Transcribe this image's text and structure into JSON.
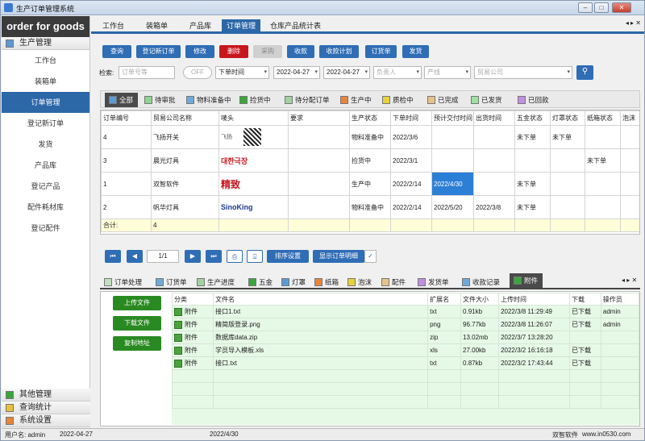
{
  "window": {
    "title": "生产订单管理系统",
    "min": "–",
    "max": "□",
    "close": "✕"
  },
  "brand": "order for goods",
  "sidebar": {
    "group_label": "生产管理",
    "items": [
      "工作台",
      "装箱单",
      "订单管理",
      "登记新订单",
      "发货",
      "产品库",
      "登记产品",
      "配件耗材库",
      "登记配件"
    ],
    "bottom_groups": [
      {
        "label": "其他管理",
        "color": "#3aa63a"
      },
      {
        "label": "查询统计",
        "color": "#e8c23a"
      },
      {
        "label": "系统设置",
        "color": "#e8843a"
      }
    ]
  },
  "top_tabs": [
    "工作台",
    "装箱单",
    "产品库",
    "订单管理",
    "仓库产品统计表"
  ],
  "top_arrows": "◂ ▸ ✕",
  "toolbar": [
    "查询",
    "登记新订单",
    "修改",
    "删除",
    "采购",
    "收款",
    "收款计划",
    "订货单",
    "发货"
  ],
  "search": {
    "label": "检索:",
    "order_placeholder": "订单号等",
    "toggle_label": "OFF",
    "time_type": "下单时间",
    "date_from": "2022-04-27",
    "date_to": "2022-04-27",
    "owner_placeholder": "负责人",
    "line_placeholder": "产线",
    "company_placeholder": "贸易公司"
  },
  "status_tabs": [
    {
      "label": "全部",
      "color": "#5b9bd5"
    },
    {
      "label": "待审批",
      "color": "#8fd48f"
    },
    {
      "label": "物料准备中",
      "color": "#6fa8dc"
    },
    {
      "label": "捡货中",
      "color": "#3aa63a"
    },
    {
      "label": "待分配订单",
      "color": "#9fd39f"
    },
    {
      "label": "生产中",
      "color": "#e8843a"
    },
    {
      "label": "质检中",
      "color": "#e8d23a"
    },
    {
      "label": "已完成",
      "color": "#e8c28a"
    },
    {
      "label": "已发货",
      "color": "#a0e0a0"
    },
    {
      "label": "已回款",
      "color": "#c090e0"
    }
  ],
  "orders": {
    "columns": [
      "订单编号",
      "贸易公司名称",
      "唛头",
      "要求",
      "生产状态",
      "下单时间",
      "预计交付时间",
      "出货时间",
      "五金状态",
      "灯罩状态",
      "纸箱状态",
      "泡沫"
    ],
    "rows": [
      {
        "id": "4",
        "company": "飞扬开关",
        "logo": "飞扬",
        "demand": "",
        "status": "物料准备中",
        "order_time": "2022/3/6",
        "delivery": "",
        "ship": "",
        "hw": "未下单",
        "lamp": "未下单",
        "box": "",
        "foam": ""
      },
      {
        "id": "3",
        "company": "晨光灯具",
        "logo": "대한극장",
        "demand": "",
        "status": "捡货中",
        "order_time": "2022/3/1",
        "delivery": "",
        "ship": "",
        "hw": "",
        "lamp": "",
        "box": "未下单",
        "foam": ""
      },
      {
        "id": "1",
        "company": "双智软件",
        "logo": "精致",
        "demand": "",
        "status": "生产中",
        "order_time": "2022/2/14",
        "delivery": "2022/4/30",
        "ship": "",
        "hw": "未下单",
        "lamp": "",
        "box": "",
        "foam": ""
      },
      {
        "id": "2",
        "company": "帆华灯具",
        "logo": "SinoKing",
        "demand": "",
        "status": "物料准备中",
        "order_time": "2022/2/14",
        "delivery": "2022/5/20",
        "ship": "2022/3/8",
        "hw": "未下单",
        "lamp": "",
        "box": "",
        "foam": ""
      }
    ],
    "sum_label": "合计:",
    "sum_value": "4"
  },
  "pager": {
    "page": "1/1",
    "sort_btn": "排序设置",
    "show_btn": "显示订单明细"
  },
  "bottom_tabs": [
    {
      "label": "订单处理",
      "color": "#c0e0c0"
    },
    {
      "label": "订货单",
      "color": "#6fa8dc"
    },
    {
      "label": "生产进度",
      "color": "#9fd39f"
    },
    {
      "label": "五金",
      "color": "#3aa63a"
    },
    {
      "label": "灯罩",
      "color": "#5b9bd5"
    },
    {
      "label": "纸箱",
      "color": "#e8843a"
    },
    {
      "label": "泡沫",
      "color": "#e8d23a"
    },
    {
      "label": "配件",
      "color": "#e8c28a"
    },
    {
      "label": "发货单",
      "color": "#c090e0"
    },
    {
      "label": "收款记录",
      "color": "#6fa8dc"
    },
    {
      "label": "附件",
      "color": "#3aa63a"
    }
  ],
  "attach_buttons": [
    "上传文件",
    "下载文件",
    "复制地址"
  ],
  "attachments": {
    "columns": [
      "分类",
      "文件名",
      "扩展名",
      "文件大小",
      "上传时间",
      "下载",
      "操作员"
    ],
    "rows": [
      {
        "cat": "附件",
        "name": "接口1.txt",
        "ext": "txt",
        "size": "0.91kb",
        "time": "2022/3/8 11:29:49",
        "dl": "已下载",
        "op": "admin"
      },
      {
        "cat": "附件",
        "name": "精简版登录.png",
        "ext": "png",
        "size": "96.77kb",
        "time": "2022/3/8 11:26:07",
        "dl": "已下载",
        "op": "admin"
      },
      {
        "cat": "附件",
        "name": "数据库data.zip",
        "ext": "zip",
        "size": "13.02mb",
        "time": "2022/3/7 13:28:20",
        "dl": "",
        "op": ""
      },
      {
        "cat": "附件",
        "name": "学员导入模板.xls",
        "ext": "xls",
        "size": "27.00kb",
        "time": "2022/3/2 16:16:18",
        "dl": "已下载",
        "op": ""
      },
      {
        "cat": "附件",
        "name": "接口.txt",
        "ext": "txt",
        "size": "0.87kb",
        "time": "2022/3/2 17:43:44",
        "dl": "已下载",
        "op": ""
      }
    ]
  },
  "statusbar": {
    "user": "用户名: admin",
    "date": "2022-04-27",
    "sel_date": "2022/4/30",
    "company": "双智软件",
    "site": "www.in0530.com"
  }
}
